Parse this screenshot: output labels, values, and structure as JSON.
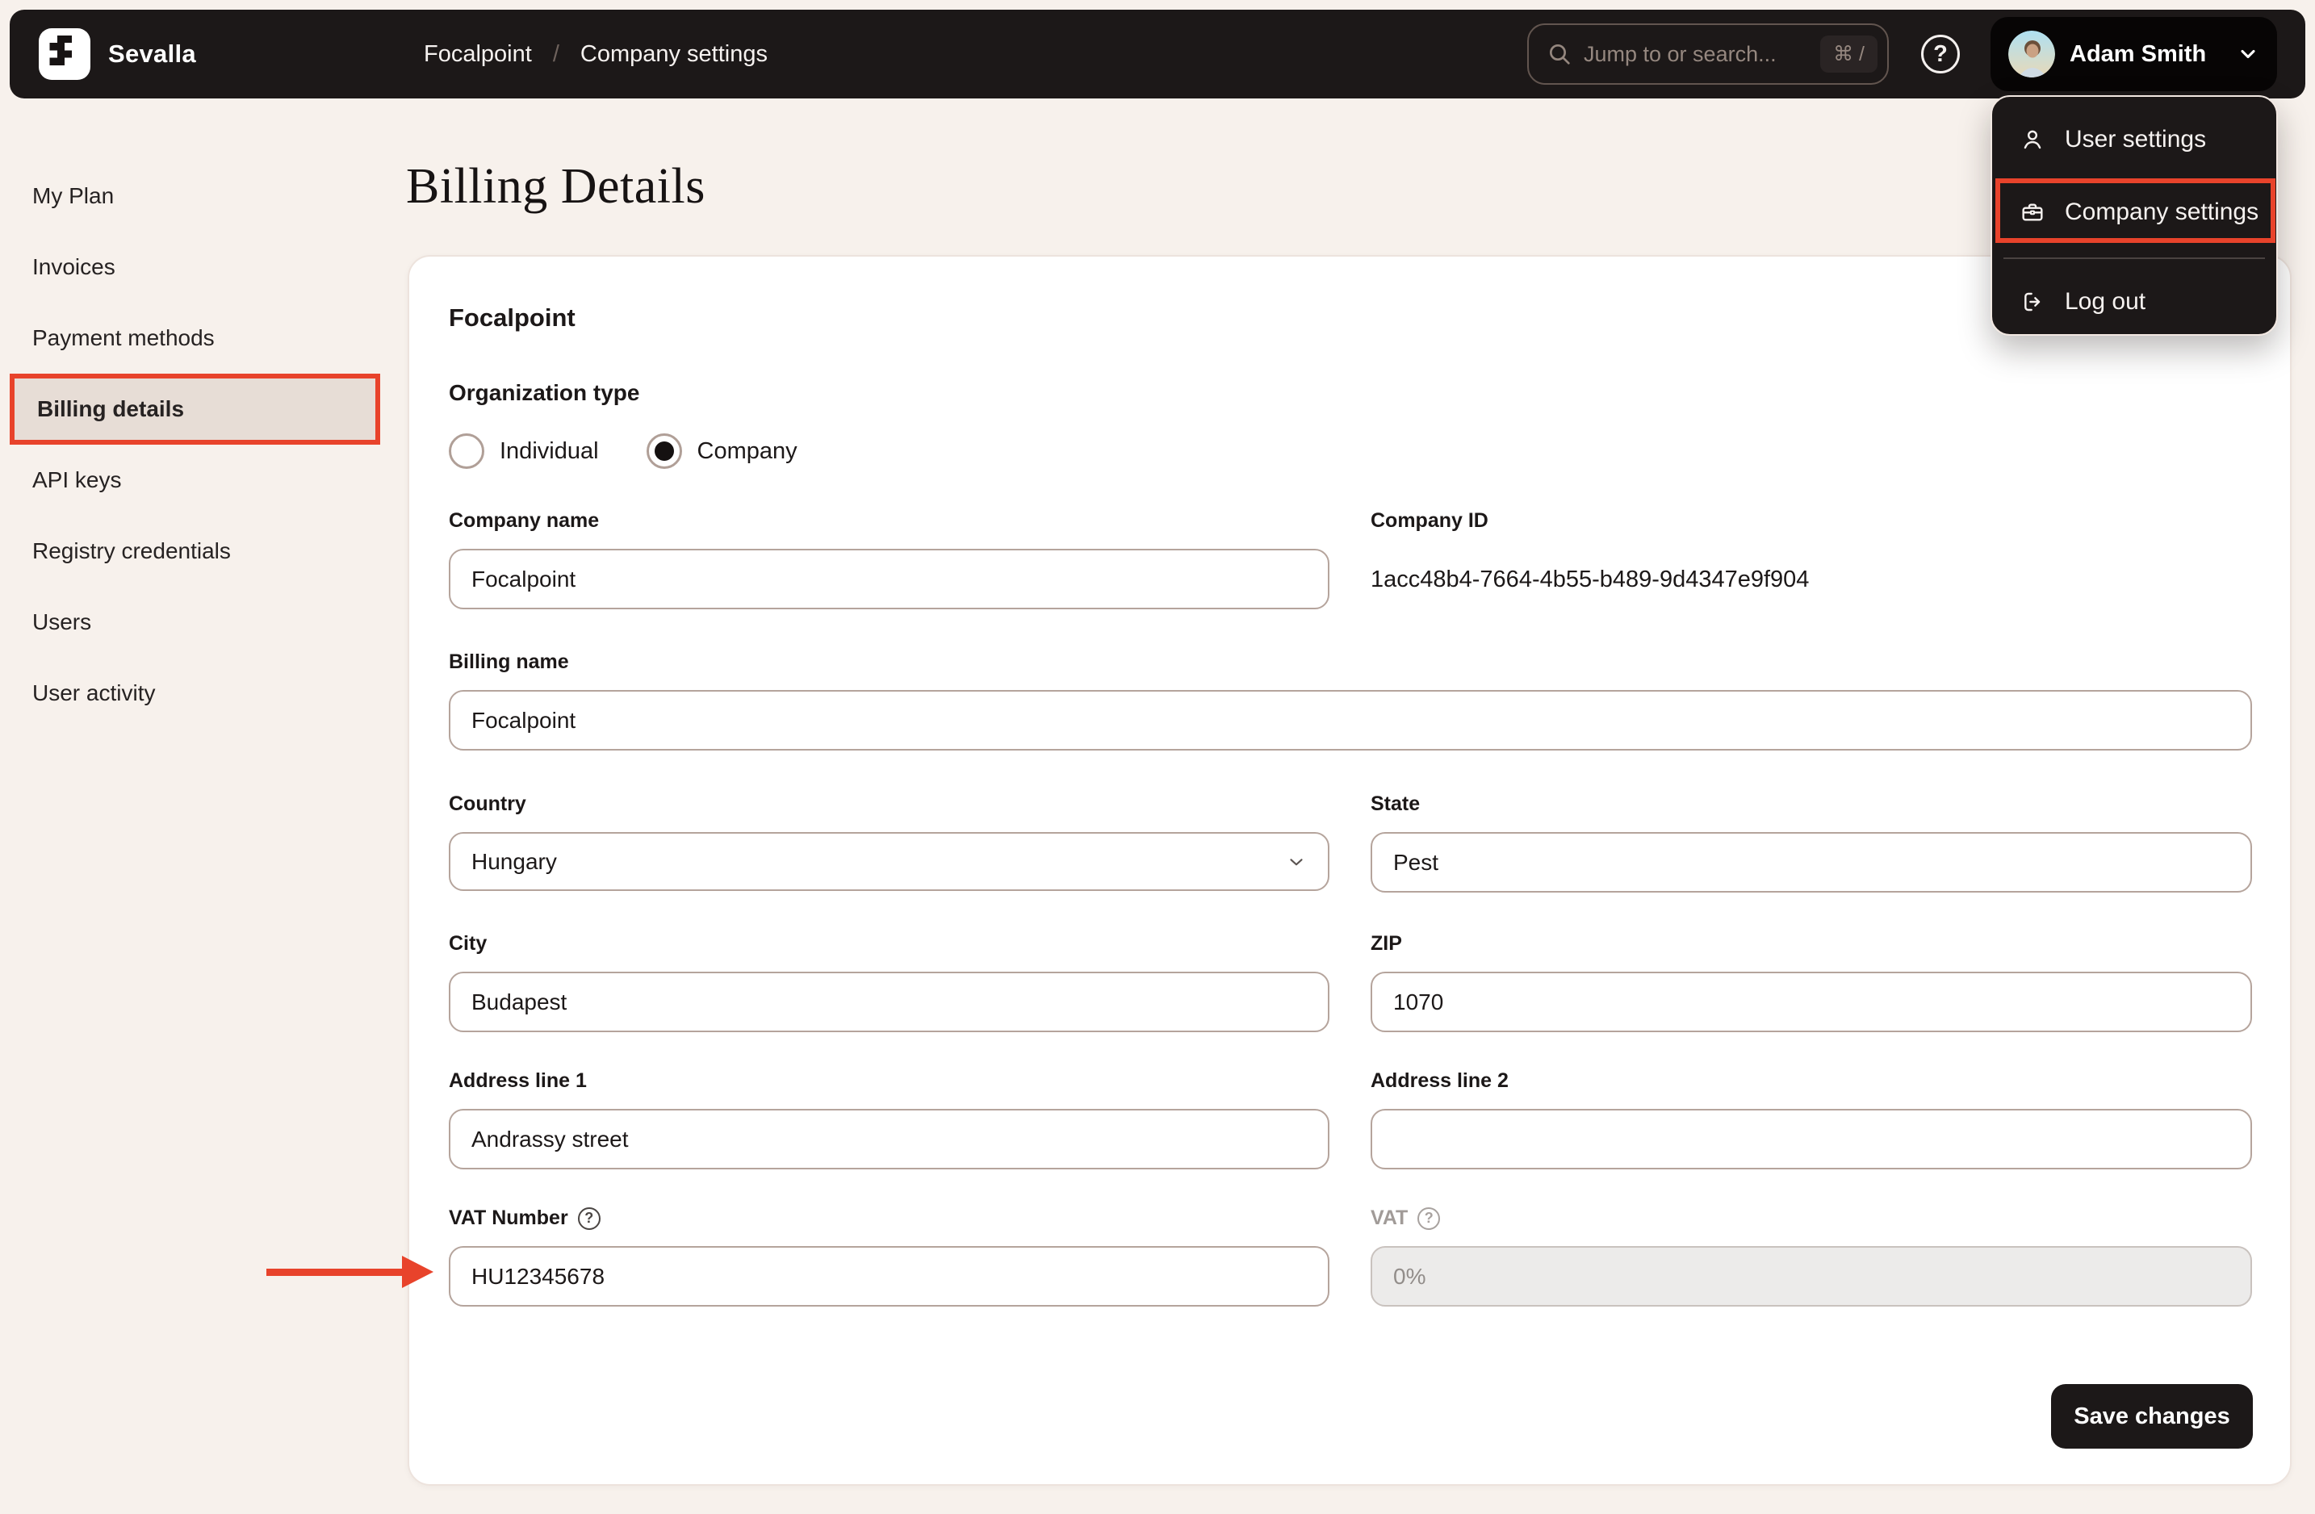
{
  "topbar": {
    "brand": "Sevalla",
    "breadcrumb": {
      "parent": "Focalpoint",
      "separator": "/",
      "current": "Company settings"
    },
    "search": {
      "placeholder": "Jump to or search...",
      "shortcut": "⌘ /"
    },
    "help_label": "?",
    "user": {
      "name": "Adam Smith"
    }
  },
  "user_menu": {
    "items": [
      {
        "label": "User settings",
        "icon": "user-icon"
      },
      {
        "label": "Company settings",
        "icon": "briefcase-icon",
        "annotated": true
      },
      {
        "label": "Log out",
        "icon": "logout-icon"
      }
    ]
  },
  "sidebar": {
    "items": [
      {
        "label": "My Plan",
        "active": false
      },
      {
        "label": "Invoices",
        "active": false
      },
      {
        "label": "Payment methods",
        "active": false
      },
      {
        "label": "Billing details",
        "active": true,
        "annotated": true
      },
      {
        "label": "API keys",
        "active": false
      },
      {
        "label": "Registry credentials",
        "active": false
      },
      {
        "label": "Users",
        "active": false
      },
      {
        "label": "User activity",
        "active": false
      }
    ]
  },
  "page": {
    "title": "Billing Details"
  },
  "form": {
    "card_title": "Focalpoint",
    "organization_type": {
      "label": "Organization type",
      "options": [
        {
          "label": "Individual",
          "selected": false
        },
        {
          "label": "Company",
          "selected": true
        }
      ]
    },
    "fields": {
      "company_name": {
        "label": "Company name",
        "value": "Focalpoint"
      },
      "company_id": {
        "label": "Company ID",
        "value": "1acc48b4-7664-4b55-b489-9d4347e9f904"
      },
      "billing_name": {
        "label": "Billing name",
        "value": "Focalpoint"
      },
      "country": {
        "label": "Country",
        "value": "Hungary"
      },
      "state": {
        "label": "State",
        "value": "Pest"
      },
      "city": {
        "label": "City",
        "value": "Budapest"
      },
      "zip": {
        "label": "ZIP",
        "value": "1070"
      },
      "address1": {
        "label": "Address line 1",
        "value": "Andrassy street"
      },
      "address2": {
        "label": "Address line 2",
        "value": ""
      },
      "vat_number": {
        "label": "VAT Number",
        "value": "HU12345678"
      },
      "vat": {
        "label": "VAT",
        "value": "0%",
        "disabled": true
      }
    },
    "save_label": "Save changes"
  },
  "colors": {
    "annotation_red": "#E8432B",
    "topbar_bg": "#1C1818",
    "page_bg": "#F7F1EC",
    "active_item_bg": "#E7DDD6",
    "input_border": "#B5A49C"
  }
}
